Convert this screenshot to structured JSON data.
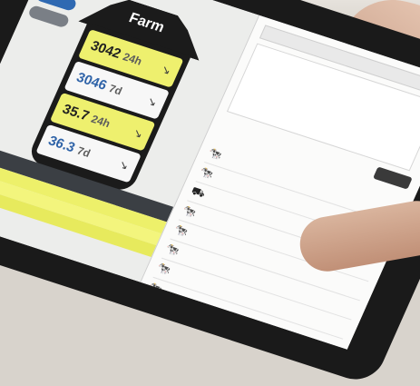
{
  "toolbar": {
    "icons": [
      "home-icon",
      "chat-icon",
      "refresh-icon",
      "folder-icon"
    ]
  },
  "side_buttons": [
    "",
    ""
  ],
  "farm": {
    "title": "Farm",
    "metrics": [
      {
        "value": "3042",
        "unit": "24h",
        "color": "#eef06e"
      },
      {
        "value": "3046",
        "unit": "7d",
        "color": "#f7f7f7"
      },
      {
        "value": "35.7",
        "unit": "24h",
        "color": "#eef06e"
      },
      {
        "value": "36.3",
        "unit": "7d",
        "color": "#f7f7f7"
      }
    ]
  },
  "bottom_panel": {
    "header": "",
    "rows": [
      "",
      "",
      ""
    ]
  },
  "right_panel": {
    "tab_label": "",
    "button_label": "",
    "events": [
      "",
      "",
      "",
      "",
      "",
      "",
      "",
      ""
    ]
  }
}
